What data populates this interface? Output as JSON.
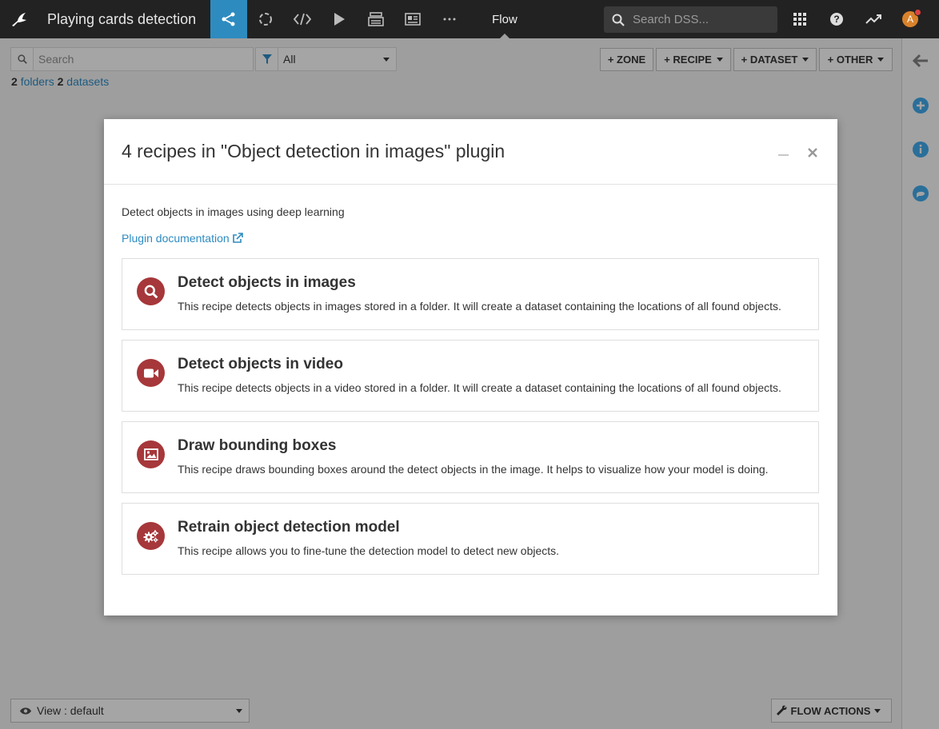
{
  "topbar": {
    "project_title": "Playing cards detection",
    "flow_label": "Flow",
    "search_placeholder": "Search DSS...",
    "avatar_initial": "A"
  },
  "toolbar": {
    "search_placeholder": "Search",
    "filter_value": "All",
    "counts": {
      "folders_num": "2",
      "folders_label": "folders",
      "datasets_num": "2",
      "datasets_label": "datasets"
    },
    "buttons": {
      "zone": "+ ZONE",
      "recipe": "+ RECIPE",
      "dataset": "+ DATASET",
      "other": "+ OTHER"
    }
  },
  "bottom": {
    "view_label": "View : default",
    "flow_actions": "FLOW ACTIONS"
  },
  "modal": {
    "title": "4 recipes in \"Object detection in images\" plugin",
    "description": "Detect objects in images using deep learning",
    "doc_link": "Plugin documentation",
    "recipes": [
      {
        "icon": "search-icon",
        "title": "Detect objects in images",
        "description": "This recipe detects objects in images stored in a folder. It will create a dataset containing the locations of all found objects."
      },
      {
        "icon": "video-camera-icon",
        "title": "Detect objects in video",
        "description": "This recipe detects objects in a video stored in a folder. It will create a dataset containing the locations of all found objects."
      },
      {
        "icon": "image-icon",
        "title": "Draw bounding boxes",
        "description": "This recipe draws bounding boxes around the detect objects in the image. It helps to visualize how your model is doing."
      },
      {
        "icon": "gears-icon",
        "title": "Retrain object detection model",
        "description": "This recipe allows you to fine-tune the detection model to detect new objects."
      }
    ]
  },
  "colors": {
    "topbar_bg": "#222222",
    "active_nav": "#2e8bc0",
    "recipe_icon_bg": "#a6373a",
    "link": "#2e8bc0",
    "rail_icon": "#2e8bc0"
  }
}
